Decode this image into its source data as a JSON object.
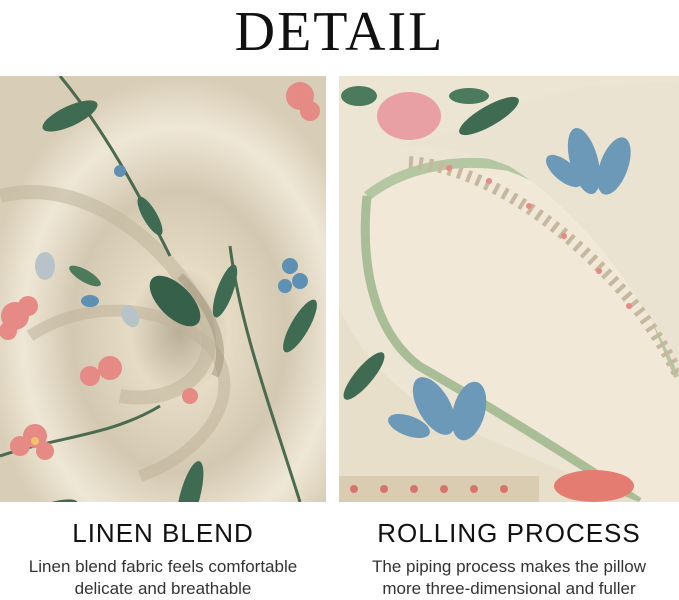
{
  "page_title": "DETAIL",
  "panels": [
    {
      "heading": "LINEN BLEND",
      "description_line1": "Linen blend fabric feels comfortable",
      "description_line2": "delicate and breathable"
    },
    {
      "heading": "ROLLING PROCESS",
      "description_line1": "The piping process makes the pillow",
      "description_line2": "more three-dimensional and fuller"
    }
  ],
  "colors": {
    "fabric": "#ece4d2",
    "leaf": "#3f6b52",
    "flower_pink": "#e58a85",
    "flower_blue": "#5d90b2",
    "piping": "#b5c7a2"
  }
}
